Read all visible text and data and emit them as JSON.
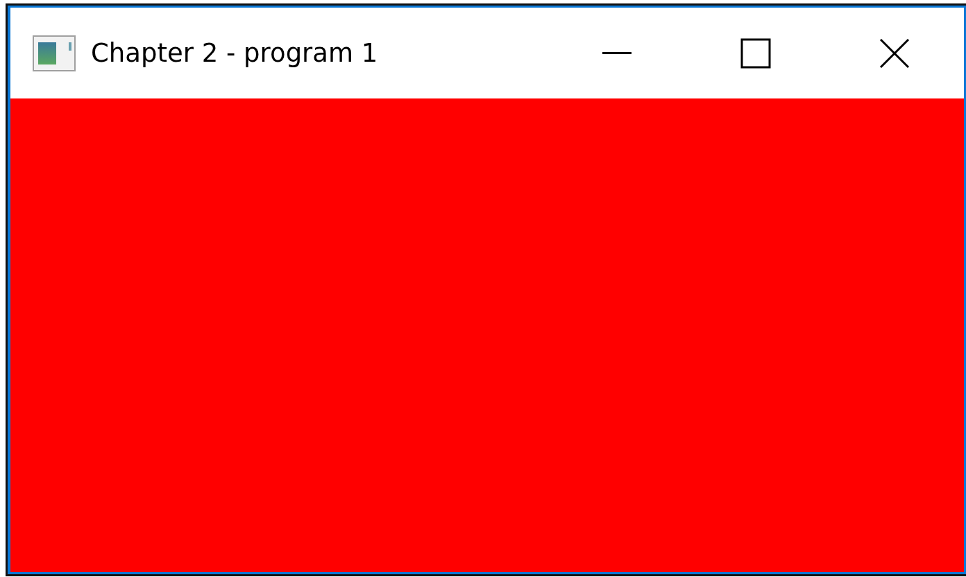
{
  "window": {
    "title": "Chapter 2 - program 1"
  }
}
